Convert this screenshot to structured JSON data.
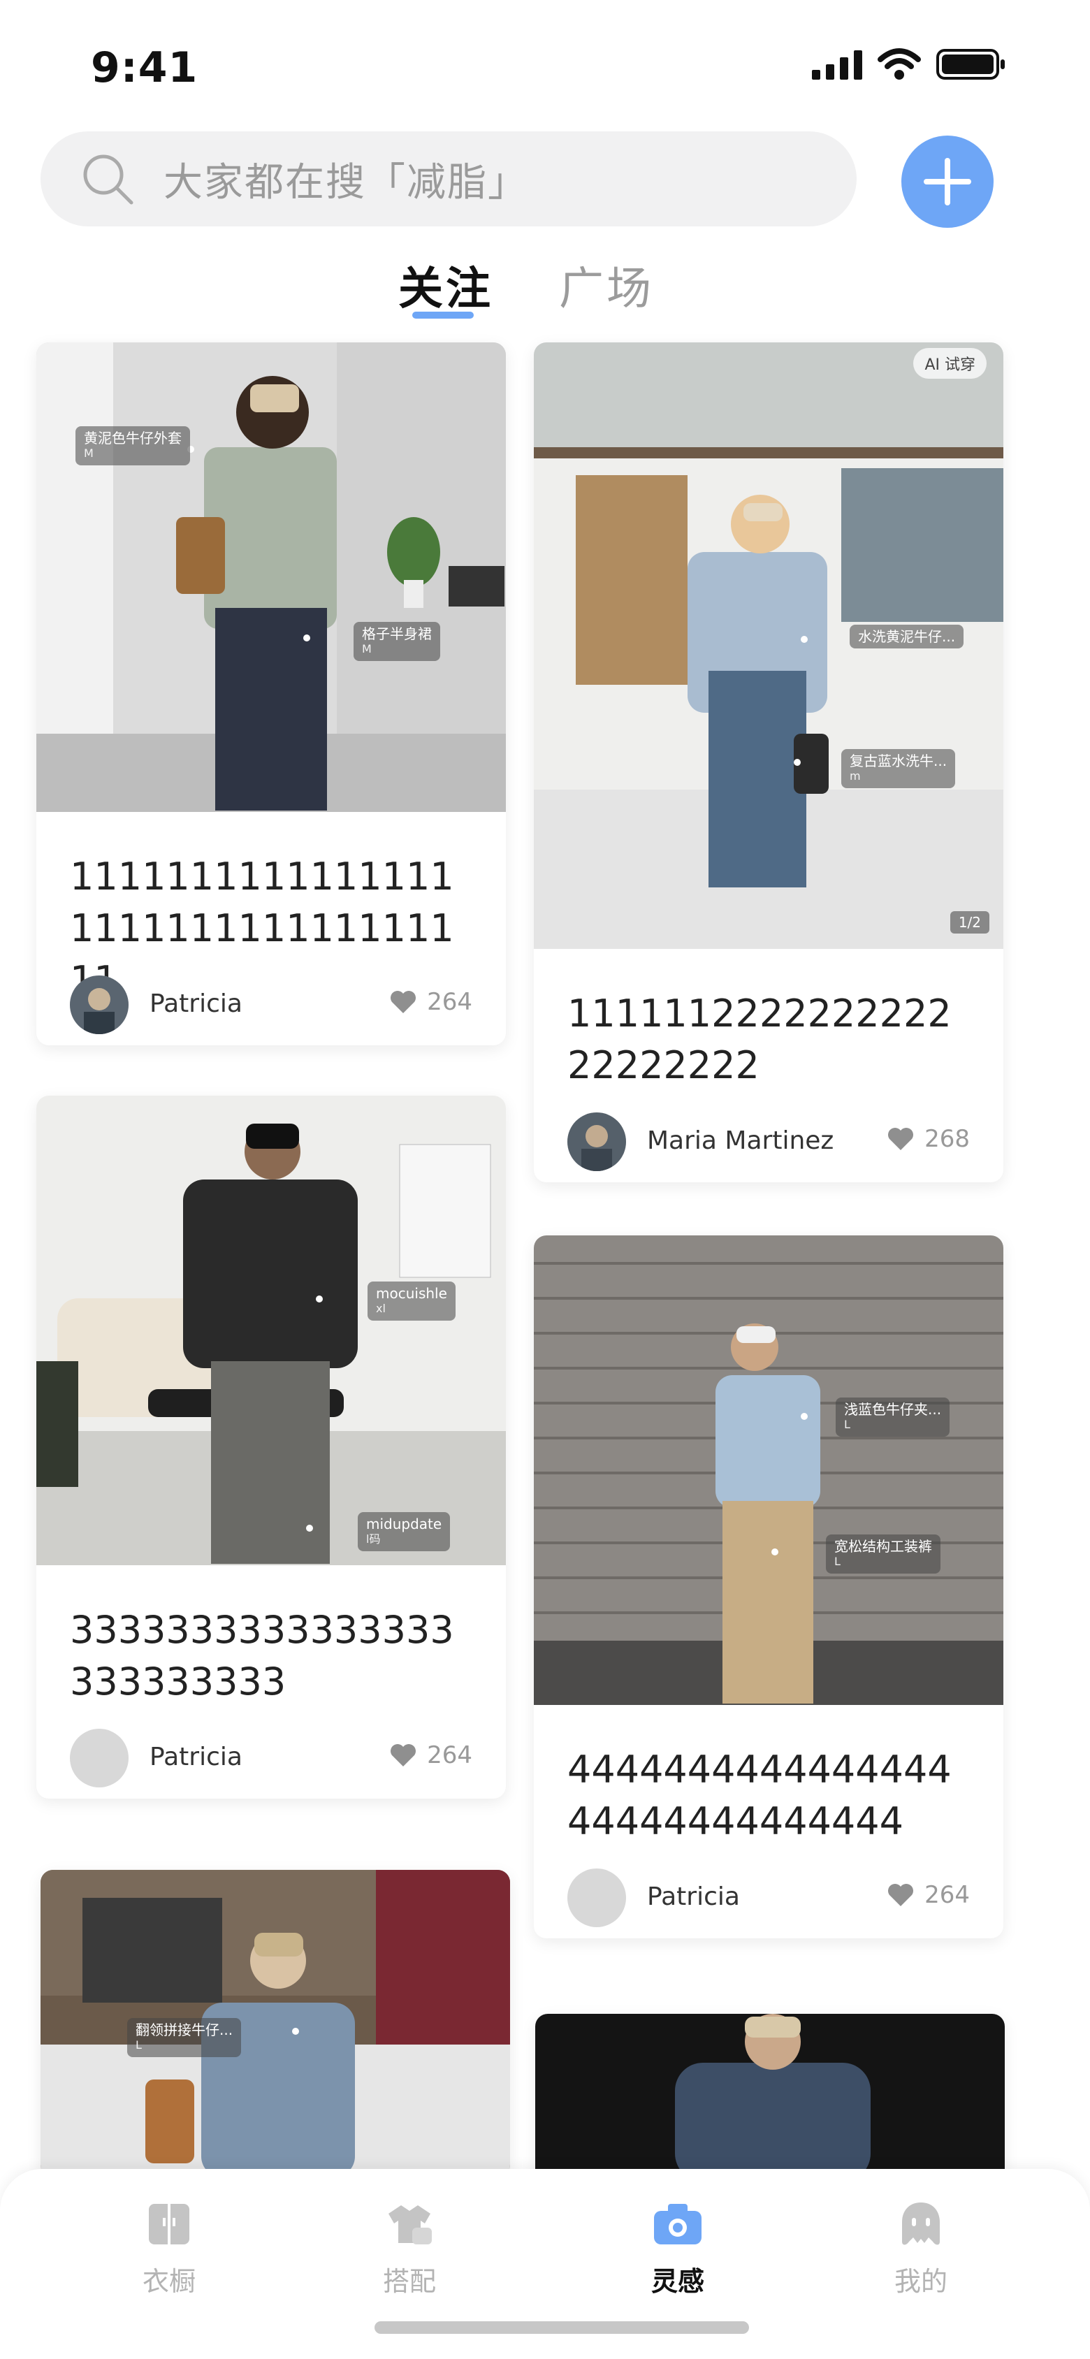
{
  "status_bar": {
    "time": "9:41"
  },
  "search": {
    "placeholder": "大家都在搜「减脂」"
  },
  "tabs": [
    {
      "label": "关注",
      "active": true
    },
    {
      "label": "广场",
      "active": false
    }
  ],
  "cards": [
    {
      "title": "1111111111111111111111111111111111",
      "author": "Patricia",
      "likes": "264",
      "tags": [
        {
          "text": "黄泥色牛仔外套",
          "size": "M"
        },
        {
          "text": "格子半身裙",
          "size": "M"
        }
      ]
    },
    {
      "title": "111111222222222222222222",
      "author": "Maria Martinez",
      "likes": "268",
      "ai_badge": "AI 试穿",
      "page_badge": "1/2",
      "tags": [
        {
          "text": "水洗黄泥牛仔...",
          "size": ""
        },
        {
          "text": "复古蓝水洗牛...",
          "size": "m"
        }
      ]
    },
    {
      "title": "3333333333333333333333333",
      "author": "Patricia",
      "likes": "264",
      "tags": [
        {
          "text": "mocuishle",
          "size": "xl"
        },
        {
          "text": "midupdate",
          "size": "l码"
        }
      ]
    },
    {
      "title": "444444444444444444444444444444",
      "author": "Patricia",
      "likes": "264",
      "tags": [
        {
          "text": "浅蓝色牛仔夹...",
          "size": "L"
        },
        {
          "text": "宽松结构工装裤",
          "size": "L"
        }
      ]
    },
    {
      "tags": [
        {
          "text": "翻领拼接牛仔...",
          "size": "L"
        }
      ]
    },
    {}
  ],
  "bottom_nav": [
    {
      "label": "衣橱",
      "icon": "wardrobe-icon",
      "active": false
    },
    {
      "label": "搭配",
      "icon": "outfit-icon",
      "active": false
    },
    {
      "label": "灵感",
      "icon": "camera-icon",
      "active": true
    },
    {
      "label": "我的",
      "icon": "profile-icon",
      "active": false
    }
  ],
  "colors": {
    "accent": "#6ea6f6",
    "inactive": "#b3b3b3"
  }
}
